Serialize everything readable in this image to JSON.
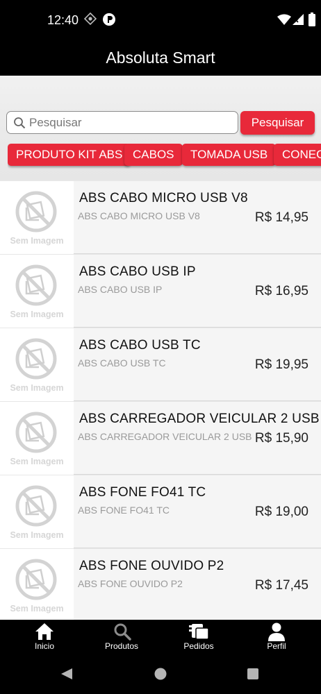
{
  "status_bar": {
    "time": "12:40"
  },
  "app_bar": {
    "title": "Absoluta Smart"
  },
  "search": {
    "placeholder": "Pesquisar",
    "button_label": "Pesquisar"
  },
  "categories": [
    "PRODUTO KIT ABS",
    "CABOS",
    "TOMADA USB",
    "CONEC"
  ],
  "products": [
    {
      "name": "ABS CABO MICRO USB V8",
      "description": "ABS CABO MICRO USB V8",
      "price": "R$ 14,95",
      "image_text": "Sem Imagem"
    },
    {
      "name": "ABS CABO USB IP",
      "description": "ABS CABO USB IP",
      "price": "R$ 16,95",
      "image_text": "Sem Imagem"
    },
    {
      "name": "ABS CABO USB TC",
      "description": "ABS CABO USB TC",
      "price": "R$ 19,95",
      "image_text": "Sem Imagem"
    },
    {
      "name": "ABS CARREGADOR VEICULAR 2 USB",
      "description": "ABS CARREGADOR VEICULAR 2 USB",
      "price": "R$ 15,90",
      "image_text": "Sem Imagem"
    },
    {
      "name": "ABS FONE FO41 TC",
      "description": "ABS FONE FO41 TC",
      "price": "R$ 19,00",
      "image_text": "Sem Imagem"
    },
    {
      "name": "ABS FONE OUVIDO P2",
      "description": "ABS FONE OUVIDO P2",
      "price": "R$ 17,45",
      "image_text": "Sem Imagem"
    }
  ],
  "bottom_nav": [
    {
      "label": "Inicio",
      "icon": "home-icon"
    },
    {
      "label": "Produtos",
      "icon": "search-icon"
    },
    {
      "label": "Pedidos",
      "icon": "orders-icon"
    },
    {
      "label": "Perfil",
      "icon": "person-icon"
    }
  ],
  "colors": {
    "accent": "#e8293a",
    "bar": "#000000",
    "list_bg": "#f5f5f5"
  }
}
